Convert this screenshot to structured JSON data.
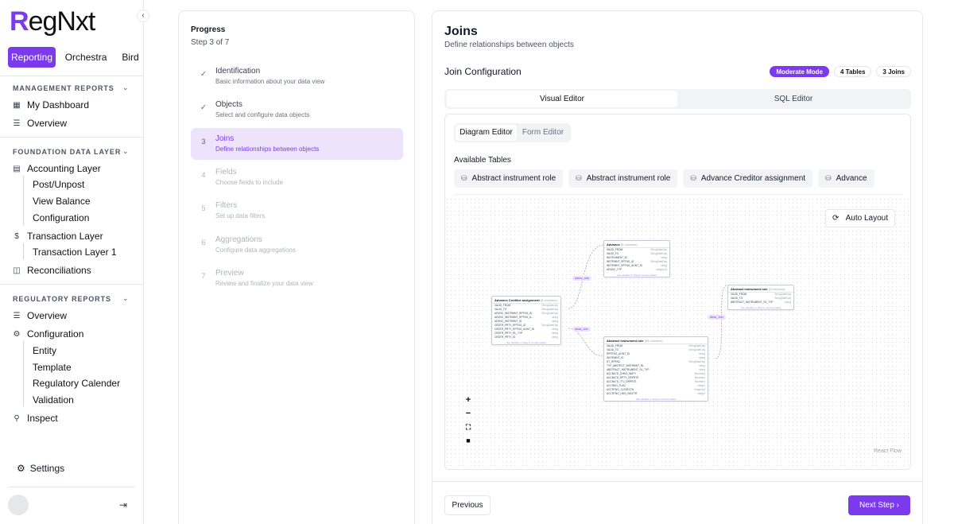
{
  "sidebar": {
    "logo": {
      "r": "R",
      "rest": "egNxt"
    },
    "tabs": [
      "Reporting",
      "Orchestra",
      "Bird"
    ],
    "sections": [
      {
        "title": "MANAGEMENT REPORTS"
      },
      {
        "title": "FOUNDATION DATA LAYER"
      },
      {
        "title": "REGULATORY REPORTS"
      }
    ],
    "items": {
      "dashboard": "My Dashboard",
      "overview1": "Overview",
      "accounting": "Accounting Layer",
      "post": "Post/Unpost",
      "balance": "View Balance",
      "config1": "Configuration",
      "transaction": "Transaction Layer",
      "transaction1": "Transaction Layer 1",
      "reconciliations": "Reconciliations",
      "overview2": "Overview",
      "config2": "Configuration",
      "entity": "Entity",
      "template": "Template",
      "calender": "Regulatory Calender",
      "validation": "Validation",
      "inspect": "Inspect",
      "settings": "Settings"
    }
  },
  "progress": {
    "title": "Progress",
    "step_text": "Step 3 of 7",
    "steps": [
      {
        "num": "✓",
        "title": "Identification",
        "desc": "Basic information about your data view"
      },
      {
        "num": "✓",
        "title": "Objects",
        "desc": "Select and configure data objects"
      },
      {
        "num": "3",
        "title": "Joins",
        "desc": "Define relationships between objects"
      },
      {
        "num": "4",
        "title": "Fields",
        "desc": "Choose fields to include"
      },
      {
        "num": "5",
        "title": "Filters",
        "desc": "Set up data filters"
      },
      {
        "num": "6",
        "title": "Aggregations",
        "desc": "Configure data aggregations"
      },
      {
        "num": "7",
        "title": "Preview",
        "desc": "Review and finalize your data view"
      }
    ]
  },
  "main": {
    "title": "Joins",
    "subtitle": "Define relationships between objects",
    "join_config": "Join Configuration",
    "badges": [
      "Moderate Mode",
      "4 Tables",
      "3 Joins"
    ],
    "editor_tabs": [
      "Visual Editor",
      "SQL Editor"
    ],
    "sub_tabs": [
      "Diagram Editor",
      "Form Editor"
    ],
    "available_tables_label": "Available Tables",
    "available_tables": [
      "Abstract instrument role",
      "Abstract instrument role",
      "Advance Creditor assignment",
      "Advance"
    ],
    "auto_layout": "Auto Layout",
    "react_flow": "React Flow",
    "previous": "Previous",
    "next_step": "Next Step"
  },
  "diagram": {
    "footer_text": "Use handles or drag to connect tables",
    "nodes": {
      "advance": {
        "name": "Advance",
        "count": "(6 columns)",
        "rows": [
          [
            "VALID_FROM",
            "StringDateDay"
          ],
          [
            "VALID_TO",
            "StringDateDay"
          ],
          [
            "INSTRUMENT_ID",
            "string"
          ],
          [
            "INSTRMNT_RPTNG_ID",
            "StringDateDay"
          ],
          [
            "INSTRMNT_RPTNG_AGNT_ID",
            "string"
          ],
          [
            "ADVNC_TYP",
            "integer(4)"
          ]
        ]
      },
      "creditor": {
        "name": "Advance Creditor assignment",
        "count": "(8 columns)",
        "rows": [
          [
            "VALID_FROM",
            "StringDateDay"
          ],
          [
            "VALID_TO",
            "StringDateDay"
          ],
          [
            "ADVNC_INSTRMNT_RPTNG_ID",
            "StringDateDay"
          ],
          [
            "ADVNC_INSTRMNT_RPTNG_A...",
            "string"
          ],
          [
            "ADVNC_INSTRMNT_ID",
            "string"
          ],
          [
            "CRDTR_PRTY_RPTNG_ID",
            "StringDateDay"
          ],
          [
            "CRDTR_PRTY_RPTNG_AGNT_ID",
            "string"
          ],
          [
            "CRDTR_PRTY_RL_TYP",
            "string"
          ],
          [
            "CRDTR_PRTY_ID",
            "string"
          ]
        ]
      },
      "role_small": {
        "name": "Abstract instrument role",
        "count": "(3 columns)",
        "rows": [
          [
            "VALID_FROM",
            "StringDateDay"
          ],
          [
            "VALID_TO",
            "StringDateDay"
          ],
          [
            "ABSTRACT_INSTRUMENT_RL_TYP",
            "string"
          ]
        ]
      },
      "role_big": {
        "name": "Abstract instrument role",
        "count": "(50 columns)",
        "rows": [
          [
            "VALID_FROM",
            "StringDateDay"
          ],
          [
            "VALID_TO",
            "StringDateDay"
          ],
          [
            "RPRTNG_AGNT_ID",
            "string"
          ],
          [
            "INSTRMNT_ID",
            "string"
          ],
          [
            "DT_RFRNC",
            "StringDateDay"
          ],
          [
            "TYP_ABSTRCT_INSTRMNT_RL",
            "string"
          ],
          [
            "ABSTRACT_INSTRUMENT_RL_TYP",
            "string"
          ],
          [
            "ACCMLTD_CHNG_NMTY",
            "Monetary"
          ],
          [
            "ACCMLTD_RPTY_DRPRTS",
            "Monetary"
          ],
          [
            "ACCMLTD_TTL_DRPRTS",
            "Monetary"
          ],
          [
            "ACCRNG_FLAG",
            "integer"
          ],
          [
            "ACCRTNG_CLSSFCTN",
            "integer(4)"
          ],
          [
            "ACCRTNG_HDG_INDCTR",
            "integer"
          ]
        ]
      }
    },
    "edge_labels": [
      "Advnc_Join",
      "Abstr_Join",
      "Abstr_Join"
    ]
  }
}
